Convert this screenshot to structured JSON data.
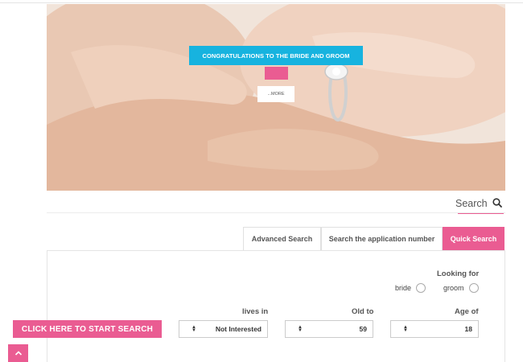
{
  "hero": {
    "banner_text": "CONGRATULATIONS TO THE BRIDE AND GROOM",
    "more_label": "...MORE"
  },
  "search": {
    "title": "Search"
  },
  "tabs": [
    {
      "label": "Advanced Search",
      "active": false
    },
    {
      "label": "Search the application number",
      "active": false
    },
    {
      "label": "Quick Search",
      "active": true
    }
  ],
  "form": {
    "looking_for_label": "Looking for",
    "options": [
      "bride",
      "groom"
    ],
    "lives_in_label": "lives in",
    "lives_in_value": "Not Interested",
    "old_to_label": "Old to",
    "old_to_value": "59",
    "age_of_label": "Age of",
    "age_of_value": "18"
  },
  "start_button_label": "CLICK HERE TO START SEARCH",
  "colors": {
    "accent": "#ea5c92",
    "banner": "#17b3df"
  },
  "icons": {
    "search": "magnifier",
    "scroll_top": "chevron-up"
  }
}
